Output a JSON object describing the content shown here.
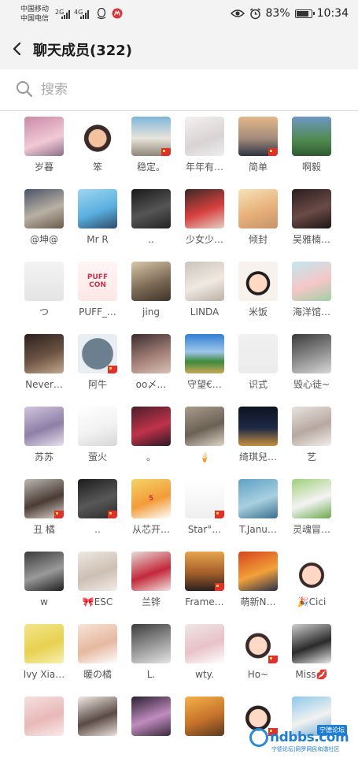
{
  "status_bar": {
    "carrier1": "中国移动",
    "carrier2": "中国电信",
    "net1": "2G",
    "net2": "4G",
    "battery": "83%",
    "time": "10:34"
  },
  "header": {
    "title": "聊天成员(322)"
  },
  "search": {
    "placeholder": "搜索"
  },
  "members": [
    {
      "name": "岁暮",
      "bg": "linear-gradient(160deg,#c98aa6,#f2c9d6 60%,#8a6f86)",
      "flag": false
    },
    {
      "name": "笨",
      "bg": "radial-gradient(circle at 50% 55%,#f3c3a0 30%,#3b2a2a 32%,#3b2a2a 45%,#ffffff 47%)",
      "flag": false
    },
    {
      "name": "稳定。",
      "bg": "linear-gradient(180deg,#7fb6d8,#e9e4dc 55%,#8e8677)",
      "flag": true
    },
    {
      "name": "年年有…",
      "bg": "linear-gradient(160deg,#f4f1f0,#d9d3d4 60%,#eee)",
      "flag": false
    },
    {
      "name": "简单",
      "bg": "linear-gradient(180deg,#e4b78a,#a38b7b 55%,#2d3440)",
      "flag": true
    },
    {
      "name": "啊毅",
      "bg": "linear-gradient(180deg,#6f97c4,#4f8a4e 60%,#2f5a33)",
      "flag": false
    },
    {
      "name": "@坤@",
      "bg": "linear-gradient(160deg,#4a5468,#b9b0a4 55%,#6a5c4c)",
      "flag": false
    },
    {
      "name": "Mr R",
      "bg": "linear-gradient(160deg,#9fd6f0,#5ab0e0 55%,#2d4b6a)",
      "flag": false
    },
    {
      "name": "..",
      "bg": "linear-gradient(160deg,#1a1a1a,#555 55%,#222)",
      "flag": false
    },
    {
      "name": "少女少…",
      "bg": "linear-gradient(160deg,#3a2a24,#d94040 55%,#e2d1c3)",
      "flag": false
    },
    {
      "name": "倾封",
      "bg": "linear-gradient(160deg,#f6e2b8,#e8b07a 55%,#c4946e)",
      "flag": false
    },
    {
      "name": "吴雅楠…",
      "bg": "linear-gradient(160deg,#2a1e1e,#6b4b46 55%,#1c1414)",
      "flag": false
    },
    {
      "name": "つ",
      "bg": "linear-gradient(180deg,#f3f3f3,#e4e4e4)",
      "flag": false
    },
    {
      "name": "PUFF_…",
      "bg": "linear-gradient(180deg,#fff5f5,#fde6e6)",
      "flag": false,
      "deco": "PUFF CON"
    },
    {
      "name": "jing",
      "bg": "linear-gradient(160deg,#d9c7a8,#7d6b57 55%,#3d3329)",
      "flag": false
    },
    {
      "name": "LINDA",
      "bg": "linear-gradient(160deg,#cbc4bc,#efe9e2 55%,#bab1a7)",
      "flag": false
    },
    {
      "name": "米饭",
      "bg": "radial-gradient(circle at 50% 55%,#ffd9c4 30%,#1f1f1f 32%,#1f1f1f 40%,#f7f2ec 42%)",
      "flag": false
    },
    {
      "name": "海洋馆…",
      "bg": "linear-gradient(160deg,#bfe9ef,#f7c6c8 55%,#9fd0a4)",
      "flag": false
    },
    {
      "name": "Never…",
      "bg": "linear-gradient(160deg,#2a211c,#6d5444 55%,#c4a98c)",
      "flag": false
    },
    {
      "name": "阿牛",
      "bg": "radial-gradient(circle at 50% 50%,#6b7f8e 55%,#e8eef2 57%)",
      "flag": true
    },
    {
      "name": "oo〆…",
      "bg": "linear-gradient(160deg,#3a2d2d,#a27e77 55%,#d9c1b6)",
      "flag": false
    },
    {
      "name": "守望€…",
      "bg": "linear-gradient(180deg,#2f7fd0,#9fc6ea 45%,#3f8a3c 70%,#c8a85a)",
      "flag": false
    },
    {
      "name": "识式",
      "bg": "linear-gradient(180deg,#f0f0f0,#ececec)",
      "flag": false
    },
    {
      "name": "毁心徒~",
      "bg": "linear-gradient(160deg,#3b3b3b,#8f8f8f 55%,#d8d8d8)",
      "flag": false
    },
    {
      "name": "苏苏",
      "bg": "linear-gradient(160deg,#cfc6dd,#8e7fa6 55%,#e8e2ee)",
      "flag": false
    },
    {
      "name": "萤火",
      "bg": "linear-gradient(160deg,#ffffff,#f2f2f2 55%,#d6d6d6)",
      "flag": false
    },
    {
      "name": "。",
      "bg": "linear-gradient(160deg,#4a1f2a,#c0324a 55%,#2a1a24)",
      "flag": false
    },
    {
      "name": "🍦",
      "bg": "linear-gradient(160deg,#a89c8c,#6b6154 55%,#ded5c8)",
      "flag": false
    },
    {
      "name": "绮琪兒…",
      "bg": "linear-gradient(180deg,#0e1320,#1e2a46 55%,#c89040)",
      "flag": false
    },
    {
      "name": "艺",
      "bg": "linear-gradient(160deg,#e8e3e0,#b7a8a0 55%,#f2efed)",
      "flag": false
    },
    {
      "name": "丑  橘",
      "bg": "linear-gradient(160deg,#bcb7b2,#4a3b34 55%,#e0d7ce)",
      "flag": true
    },
    {
      "name": "..",
      "bg": "linear-gradient(160deg,#1c1c1c,#585858 55%,#2a2a2a)",
      "flag": true
    },
    {
      "name": "从芯开…",
      "bg": "linear-gradient(160deg,#f6d36a,#f29c37 55%,#fff)",
      "flag": false,
      "deco": "5"
    },
    {
      "name": "Star°…",
      "bg": "linear-gradient(180deg,#ffffff,#efefef)",
      "flag": true
    },
    {
      "name": "T.Janu…",
      "bg": "linear-gradient(160deg,#5fa0c4,#a8d0e0 55%,#3c6e8e)",
      "flag": false
    },
    {
      "name": "灵魂冒…",
      "bg": "linear-gradient(160deg,#9fcf7a,#f4f4f4 55%,#6aa84f)",
      "flag": false
    },
    {
      "name": "w",
      "bg": "linear-gradient(160deg,#3a3a3a,#9a9a9a 55%,#1e1e1e)",
      "flag": false
    },
    {
      "name": "🎀ESC",
      "bg": "linear-gradient(160deg,#ede8e4,#cdbfb3 55%,#f2ede9)",
      "flag": false
    },
    {
      "name": "兰铧",
      "bg": "linear-gradient(160deg,#e6dad6,#c3283a 55%,#f1e3e0)",
      "flag": false
    },
    {
      "name": "Frame…",
      "bg": "linear-gradient(180deg,#e7a44c,#a35c2a 55%,#2a2020)",
      "flag": true
    },
    {
      "name": "萌新N…",
      "bg": "linear-gradient(160deg,#d6431e,#f2a23a 55%,#2a2f4a)",
      "flag": false
    },
    {
      "name": "🎉Cici",
      "bg": "radial-gradient(circle at 50% 60%,#ffd7c2 30%,#3a2a2a 32%,#3a2a2a 40%,#fff 42%)",
      "flag": false
    },
    {
      "name": "Ivy Xia…",
      "bg": "linear-gradient(160deg,#f2e68a,#e8d050 55%,#f7f1b0)",
      "flag": false
    },
    {
      "name": "暖の橘",
      "bg": "linear-gradient(160deg,#f8e3d6,#e6b8a0 55%,#fff)",
      "flag": false
    },
    {
      "name": "L.",
      "bg": "linear-gradient(160deg,#3c3c3c,#9a9a9a 55%,#e4e4e4)",
      "flag": false
    },
    {
      "name": "wty.",
      "bg": "linear-gradient(160deg,#efe6e6,#e7c2c8 55%,#fff)",
      "flag": false
    },
    {
      "name": "Ho~",
      "bg": "radial-gradient(circle at 50% 55%,#ffd9c4 30%,#3a2a2a 32%,#3a2a2a 42%,#fff 44%)",
      "flag": true
    },
    {
      "name": "Miss💋",
      "bg": "linear-gradient(160deg,#cfcfcf,#2a2a2a 55%,#e8e8e8)",
      "flag": false
    },
    {
      "name": "",
      "bg": "linear-gradient(160deg,#f6e0e0,#e8b8b8 55%,#fbeaea)",
      "flag": false
    },
    {
      "name": "",
      "bg": "linear-gradient(160deg,#f2ebe6,#5a4a44 55%,#ece4de)",
      "flag": false
    },
    {
      "name": "",
      "bg": "linear-gradient(160deg,#2a2030,#c08cc0 55%,#3a2a3a)",
      "flag": false
    },
    {
      "name": "",
      "bg": "linear-gradient(160deg,#f2b24a,#c7722a 55%,#5a3a20)",
      "flag": false
    },
    {
      "name": "",
      "bg": "radial-gradient(circle at 50% 55%,#ffd9c4 30%,#2a2020 32%,#2a2020 42%,#fff 44%)",
      "flag": true
    },
    {
      "name": "",
      "bg": "linear-gradient(160deg,#8ec8e8,#f2f2f2 55%,#6fa8d0)",
      "flag": false
    }
  ],
  "watermark": {
    "text": "ndbbs.com",
    "tag": "宁德论坛",
    "small": "宁德论坛|网罗网民和谐社区"
  },
  "colors": {
    "header_bg": "#f3f3f3",
    "flag_red": "#e0302c",
    "watermark_blue": "#1e7ed0"
  }
}
